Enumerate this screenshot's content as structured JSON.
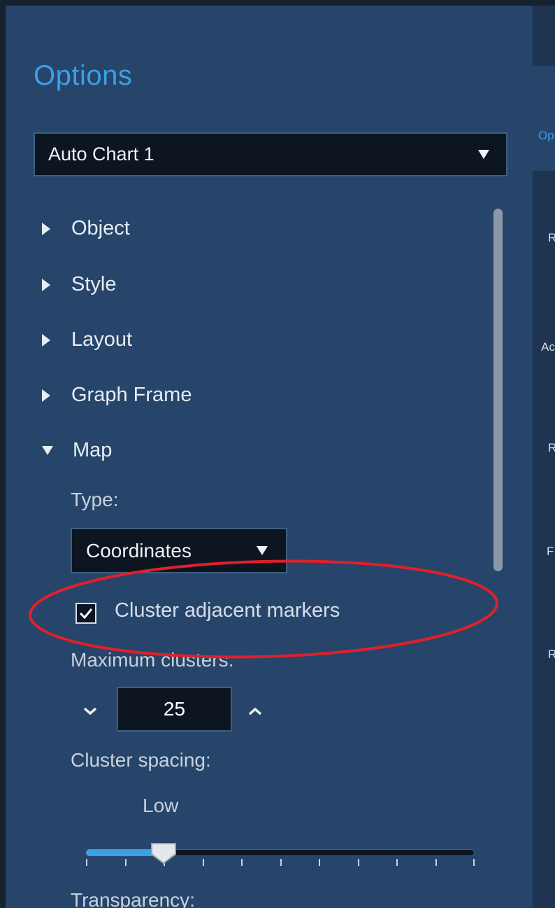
{
  "panel": {
    "title": "Options",
    "object_select": {
      "value": "Auto Chart 1"
    }
  },
  "sections": [
    {
      "label": "Object",
      "expanded": false
    },
    {
      "label": "Style",
      "expanded": false
    },
    {
      "label": "Layout",
      "expanded": false
    },
    {
      "label": "Graph Frame",
      "expanded": false
    },
    {
      "label": "Map",
      "expanded": true
    }
  ],
  "map": {
    "type_label": "Type:",
    "type_value": "Coordinates",
    "cluster_checkbox": {
      "label": "Cluster adjacent markers",
      "checked": true
    },
    "max_clusters_label": "Maximum clusters:",
    "max_clusters_value": "25",
    "cluster_spacing_label": "Cluster spacing:",
    "cluster_spacing_value": "Low",
    "cluster_spacing_level": 0.2,
    "transparency_label": "Transparency:"
  },
  "right_strip": {
    "texts": [
      "Op",
      "R",
      "Ac",
      "R",
      "F",
      "R"
    ]
  },
  "colors": {
    "accent": "#3aa0e6",
    "panel_bg": "#27456a",
    "input_bg": "#0c1520",
    "annotation": "#e0202a"
  },
  "icons": {
    "dropdown": "caret-down-icon",
    "collapsed": "triangle-right-icon",
    "expanded": "triangle-down-icon",
    "check": "checkmark-icon",
    "decrement": "chevron-down-icon",
    "increment": "chevron-up-icon"
  }
}
